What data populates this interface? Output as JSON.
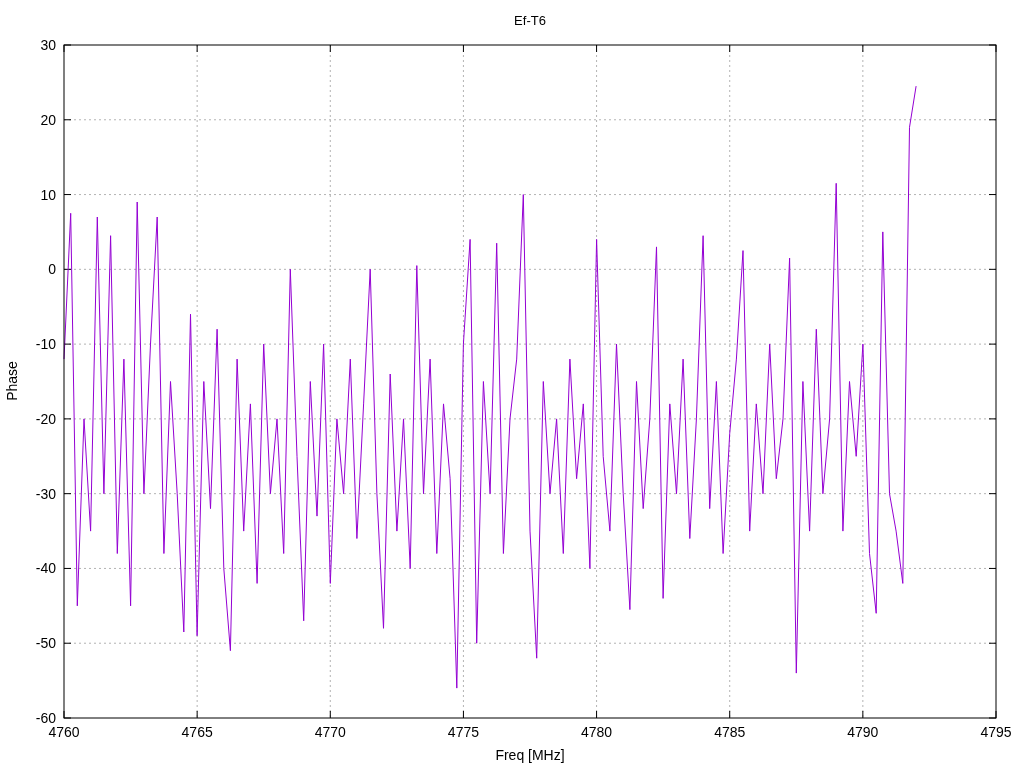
{
  "chart_data": {
    "type": "line",
    "title": "Ef-T6",
    "xlabel": "Freq [MHz]",
    "ylabel": "Phase",
    "xlim": [
      4760,
      4795
    ],
    "ylim": [
      -60,
      30
    ],
    "grid": true,
    "xticks": [
      4760,
      4765,
      4770,
      4775,
      4780,
      4785,
      4790,
      4795
    ],
    "yticks": [
      -60,
      -50,
      -40,
      -30,
      -20,
      -10,
      0,
      10,
      20,
      30
    ],
    "x": [
      4760,
      4760.25,
      4760.5,
      4760.75,
      4761,
      4761.25,
      4761.5,
      4761.75,
      4762,
      4762.25,
      4762.5,
      4762.75,
      4763,
      4763.25,
      4763.5,
      4763.75,
      4764,
      4764.25,
      4764.5,
      4764.75,
      4765,
      4765.25,
      4765.5,
      4765.75,
      4766,
      4766.25,
      4766.5,
      4766.75,
      4767,
      4767.25,
      4767.5,
      4767.75,
      4768,
      4768.25,
      4768.5,
      4768.75,
      4769,
      4769.25,
      4769.5,
      4769.75,
      4770,
      4770.25,
      4770.5,
      4770.75,
      4771,
      4771.25,
      4771.5,
      4771.75,
      4772,
      4772.25,
      4772.5,
      4772.75,
      4773,
      4773.25,
      4773.5,
      4773.75,
      4774,
      4774.25,
      4774.5,
      4774.75,
      4775,
      4775.25,
      4775.5,
      4775.75,
      4776,
      4776.25,
      4776.5,
      4776.75,
      4777,
      4777.25,
      4777.5,
      4777.75,
      4778,
      4778.25,
      4778.5,
      4778.75,
      4779,
      4779.25,
      4779.5,
      4779.75,
      4780,
      4780.25,
      4780.5,
      4780.75,
      4781,
      4781.25,
      4781.5,
      4781.75,
      4782,
      4782.25,
      4782.5,
      4782.75,
      4783,
      4783.25,
      4783.5,
      4783.75,
      4784,
      4784.25,
      4784.5,
      4784.75,
      4785,
      4785.25,
      4785.5,
      4785.75,
      4786,
      4786.25,
      4786.5,
      4786.75,
      4787,
      4787.25,
      4787.5,
      4787.75,
      4788,
      4788.25,
      4788.5,
      4788.75,
      4789,
      4789.25,
      4789.5,
      4789.75,
      4790,
      4790.25,
      4790.5,
      4790.75,
      4791,
      4791.25,
      4791.5,
      4791.75,
      4792
    ],
    "series": [
      {
        "color": "#9400d3",
        "values": [
          -12,
          7.5,
          -45,
          -20,
          -35,
          7,
          -30,
          4.5,
          -38,
          -12,
          -45,
          9,
          -30,
          -10,
          7,
          -38,
          -15,
          -30,
          -48.5,
          -6,
          -49,
          -15,
          -32,
          -8,
          -40,
          -51,
          -12,
          -35,
          -18,
          -42,
          -10,
          -30,
          -20,
          -38,
          0,
          -25,
          -47,
          -15,
          -33,
          -10,
          -42,
          -20,
          -30,
          -12,
          -36,
          -18,
          0,
          -30,
          -48,
          -14,
          -35,
          -20,
          -40,
          0.5,
          -30,
          -12,
          -38,
          -18,
          -28,
          -56,
          -10,
          4,
          -50,
          -15,
          -30,
          3.5,
          -38,
          -20,
          -12,
          10,
          -35,
          -52,
          -15,
          -30,
          -20,
          -38,
          -12,
          -28,
          -18,
          -40,
          4,
          -25,
          -35,
          -10,
          -30,
          -45.5,
          -15,
          -32,
          -20,
          3,
          -44,
          -18,
          -30,
          -12,
          -36,
          -20,
          4.5,
          -32,
          -15,
          -38,
          -22,
          -12,
          2.5,
          -35,
          -18,
          -30,
          -10,
          -28,
          -20,
          1.5,
          -54,
          -15,
          -35,
          -8,
          -30,
          -20,
          11.5,
          -35,
          -15,
          -25,
          -10,
          -38,
          -46,
          5,
          -30,
          -35,
          -42,
          19,
          24.5
        ]
      }
    ]
  }
}
